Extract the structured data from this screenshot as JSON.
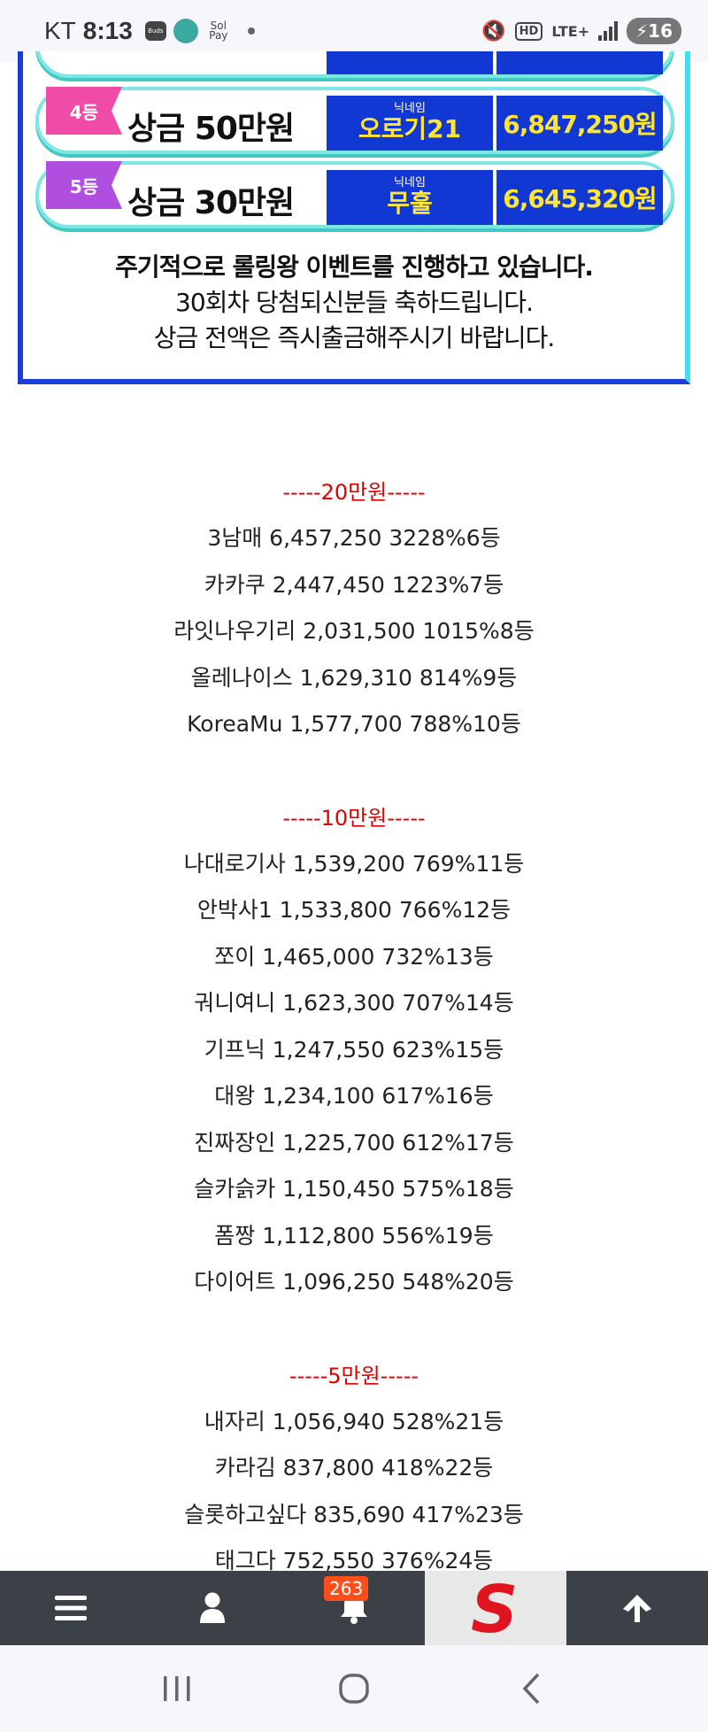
{
  "status_bar": {
    "carrier": "KT",
    "time": "8:13",
    "buds_label": "Buds",
    "pay_label": "Sol Pay",
    "hd_label": "HD",
    "network_label": "LTE+",
    "battery_level": "16"
  },
  "banner": {
    "rows": [
      {
        "rank": "",
        "prize": "",
        "nick_label": "",
        "nickname": "",
        "amount": ""
      },
      {
        "rank": "4등",
        "prize": "상금 50만원",
        "nick_label": "닉네임",
        "nickname": "오로기21",
        "amount": "6,847,250원"
      },
      {
        "rank": "5등",
        "prize": "상금 30만원",
        "nick_label": "닉네임",
        "nickname": "무훌",
        "amount": "6,645,320원"
      }
    ],
    "notes": [
      "주기적으로 롤링왕 이벤트를 진행하고 있습니다.",
      "30회차 당첨되신분들 축하드립니다.",
      "상금 전액은 즉시출금해주시기 바랍니다."
    ]
  },
  "ranking": {
    "tiers": [
      {
        "title": "-----20만원-----",
        "entries": [
          "3남매 6,457,250 3228%6등",
          "카카쿠 2,447,450 1223%7등",
          "라잇나우기리 2,031,500 1015%8등",
          "올레나이스 1,629,310 814%9등",
          "KoreaMu 1,577,700 788%10등"
        ]
      },
      {
        "title": "-----10만원-----",
        "entries": [
          "나대로기사 1,539,200 769%11등",
          "안박사1 1,533,800 766%12등",
          "쪼이 1,465,000 732%13등",
          "궈니여니 1,623,300 707%14등",
          "기프닉 1,247,550 623%15등",
          "대왕 1,234,100 617%16등",
          "진짜장인 1,225,700 612%17등",
          "슬카슭카 1,150,450 575%18등",
          "폼짱 1,112,800 556%19등",
          "다이어트 1,096,250 548%20등"
        ]
      },
      {
        "title": "-----5만원-----",
        "entries": [
          "내자리 1,056,940 528%21등",
          "카라김 837,800 418%22등",
          "슬롯하고싶다 835,690 417%23등",
          "태그다 752,550 376%24등"
        ]
      }
    ]
  },
  "toolbar": {
    "notification_count": "263",
    "logo_letter": "S"
  },
  "colors": {
    "toolbar_bg": "#3c4147",
    "badge": "#ff4e1a",
    "logo_red": "#e0141e",
    "tier_title": "#e00000",
    "banner_blue": "#1238d4",
    "banner_yellow": "#ffe533"
  }
}
